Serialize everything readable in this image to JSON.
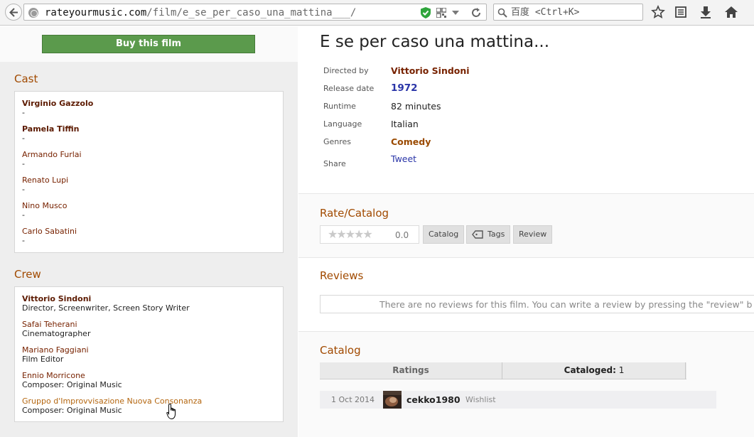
{
  "browser": {
    "url_host": "rateyourmusic.com",
    "url_path": "/film/e_se_per_caso_una_mattina___/",
    "search_placeholder": "百度 <Ctrl+K>"
  },
  "buy_button": "Buy this film",
  "cast": {
    "title": "Cast",
    "members": [
      {
        "name": "Virginio Gazzolo",
        "role": "-"
      },
      {
        "name": "Pamela Tiffin",
        "role": "-"
      },
      {
        "name": "Armando Furlai",
        "role": "-"
      },
      {
        "name": "Renato Lupi",
        "role": "-"
      },
      {
        "name": "Nino Musco",
        "role": "-"
      },
      {
        "name": "Carlo Sabatini",
        "role": "-"
      }
    ]
  },
  "crew": {
    "title": "Crew",
    "members": [
      {
        "name": "Vittorio Sindoni",
        "role": "Director, Screenwriter, Screen Story Writer"
      },
      {
        "name": "Safai Teherani",
        "role": "Cinematographer"
      },
      {
        "name": "Mariano Faggiani",
        "role": "Film Editor"
      },
      {
        "name": "Ennio Morricone",
        "role": "Composer: Original Music"
      },
      {
        "name": "Gruppo d'Improvvisazione Nuova Consonanza",
        "role": "Composer: Original Music"
      }
    ]
  },
  "film": {
    "title": "E se per caso una mattina...",
    "info": [
      {
        "label": "Directed by",
        "value": "Vittorio Sindoni"
      },
      {
        "label": "Release date",
        "value": "1972"
      },
      {
        "label": "Runtime",
        "value": "82 minutes"
      },
      {
        "label": "Language",
        "value": "Italian"
      },
      {
        "label": "Genres",
        "value": "Comedy"
      },
      {
        "label": "Share",
        "value": "Tweet"
      }
    ]
  },
  "rate_catalog": {
    "title": "Rate/Catalog",
    "stars": "★★★★★",
    "score": "0.0",
    "buttons": [
      "Catalog",
      "Tags",
      "Review"
    ]
  },
  "reviews": {
    "title": "Reviews",
    "empty_text": "There are no reviews for this film. You can write a review by pressing the \"review\" b"
  },
  "catalog": {
    "title": "Catalog",
    "tab_ratings": "Ratings",
    "tab_cataloged_label": "Cataloged:",
    "tab_cataloged_count": "1",
    "entries": [
      {
        "date": "1 Oct 2014",
        "user": "cekko1980",
        "status": "Wishlist"
      }
    ]
  },
  "colors": {
    "buy_green": "#5b9a4c",
    "section_title": "#a14a00",
    "link_dark_red": "#772200",
    "link_blue": "#2a35a8"
  }
}
